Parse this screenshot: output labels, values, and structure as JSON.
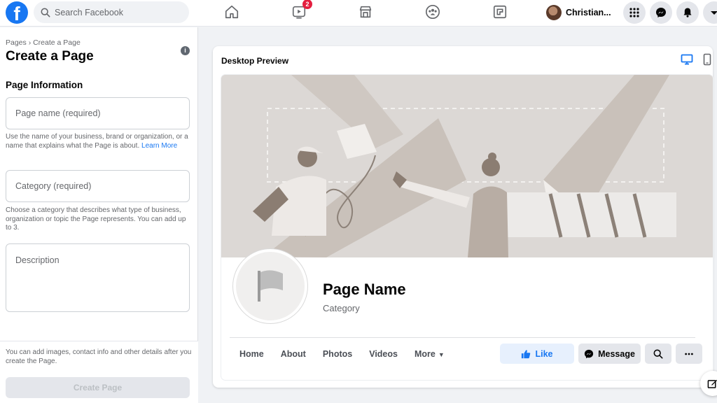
{
  "topbar": {
    "logo": "f",
    "search_placeholder": "Search Facebook",
    "nav_icons": [
      "home-icon",
      "watch-icon",
      "marketplace-icon",
      "groups-icon",
      "gaming-icon"
    ],
    "watch_badge": "2",
    "profile_name": "Christian...",
    "actions": [
      "menu-icon",
      "messenger-icon",
      "notifications-icon",
      "account-icon"
    ]
  },
  "left_panel": {
    "breadcrumb": "Pages › Create a Page",
    "title": "Create a Page",
    "section_title": "Page Information",
    "page_name_placeholder": "Page name (required)",
    "page_name_help": "Use the name of your business, brand or organization, or a name that explains what the Page is about.",
    "learn_more": "Learn More",
    "category_placeholder": "Category (required)",
    "category_help": "Choose a category that describes what type of business, organization or topic the Page represents. You can add up to 3.",
    "description_placeholder": "Description",
    "bottom_note": "You can add images, contact info and other details after you create the Page.",
    "create_button": "Create Page"
  },
  "preview": {
    "title": "Desktop Preview",
    "active_device": "desktop",
    "page_name": "Page Name",
    "category": "Category",
    "tabs": [
      "Home",
      "About",
      "Photos",
      "Videos",
      "More"
    ],
    "like_button": "Like",
    "message_button": "Message"
  },
  "colors": {
    "brand": "#1877f2",
    "badge": "#e41e3f",
    "cover_bg": "#dcd8d5"
  }
}
